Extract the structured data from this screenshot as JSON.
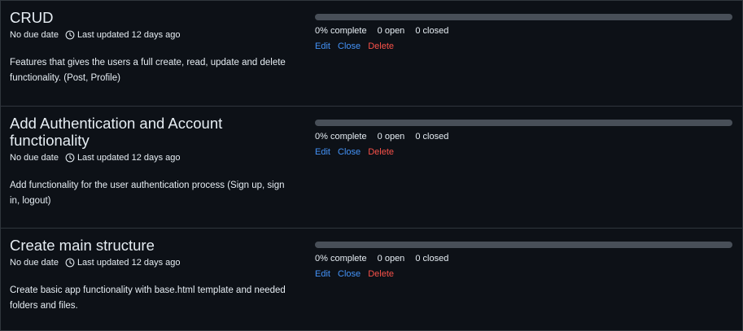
{
  "colors": {
    "background": "#0d1117",
    "border": "#30363d",
    "progress_track": "#484f58",
    "progress_fill": "#238636",
    "link": "#4493f8",
    "danger": "#f85149",
    "text": "#e6edf3"
  },
  "milestones": [
    {
      "title": "CRUD",
      "due": "No due date",
      "updated": "Last updated 12 days ago",
      "description": "Features that gives the users a full create, read, update and delete functionality. (Post, Profile)",
      "progress_percent": 0,
      "complete_label": "0% complete",
      "open_label": "0 open",
      "closed_label": "0 closed",
      "actions": {
        "edit": "Edit",
        "close": "Close",
        "delete": "Delete"
      },
      "icon": "clock-icon"
    },
    {
      "title": "Add Authentication and Account functionality",
      "due": "No due date",
      "updated": "Last updated 12 days ago",
      "description": "Add functionality for the user authentication process (Sign up, sign in, logout)",
      "progress_percent": 0,
      "complete_label": "0% complete",
      "open_label": "0 open",
      "closed_label": "0 closed",
      "actions": {
        "edit": "Edit",
        "close": "Close",
        "delete": "Delete"
      },
      "icon": "clock-icon"
    },
    {
      "title": "Create main structure",
      "due": "No due date",
      "updated": "Last updated 12 days ago",
      "description": "Create basic app functionality with base.html template and needed folders and files.",
      "progress_percent": 0,
      "complete_label": "0% complete",
      "open_label": "0 open",
      "closed_label": "0 closed",
      "actions": {
        "edit": "Edit",
        "close": "Close",
        "delete": "Delete"
      },
      "icon": "clock-icon"
    }
  ]
}
